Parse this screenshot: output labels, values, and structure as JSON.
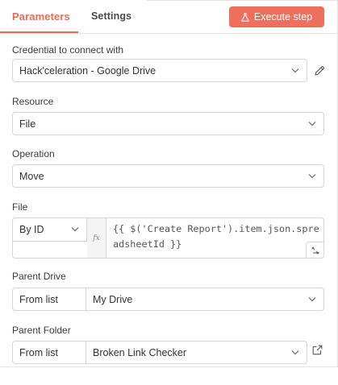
{
  "tabs": [
    {
      "label": "Parameters",
      "active": true
    },
    {
      "label": "Settings",
      "active": false
    }
  ],
  "execute_button": {
    "label": "Execute step",
    "color": "#ef6f5e"
  },
  "accent_color": "#ea6b52",
  "fields": {
    "credential": {
      "label": "Credential to connect with",
      "value": "Hack'celeration - Google Drive"
    },
    "resource": {
      "label": "Resource",
      "value": "File"
    },
    "operation": {
      "label": "Operation",
      "value": "Move"
    },
    "file": {
      "label": "File",
      "mode": "By ID",
      "expression_badge": "fx",
      "expression": "{{ $('Create Report').item.json.spreadsheetId }}"
    },
    "parent_drive": {
      "label": "Parent Drive",
      "mode": "From list",
      "value": "My Drive"
    },
    "parent_folder": {
      "label": "Parent Folder",
      "mode": "From list",
      "value": "Broken Link Checker"
    }
  }
}
